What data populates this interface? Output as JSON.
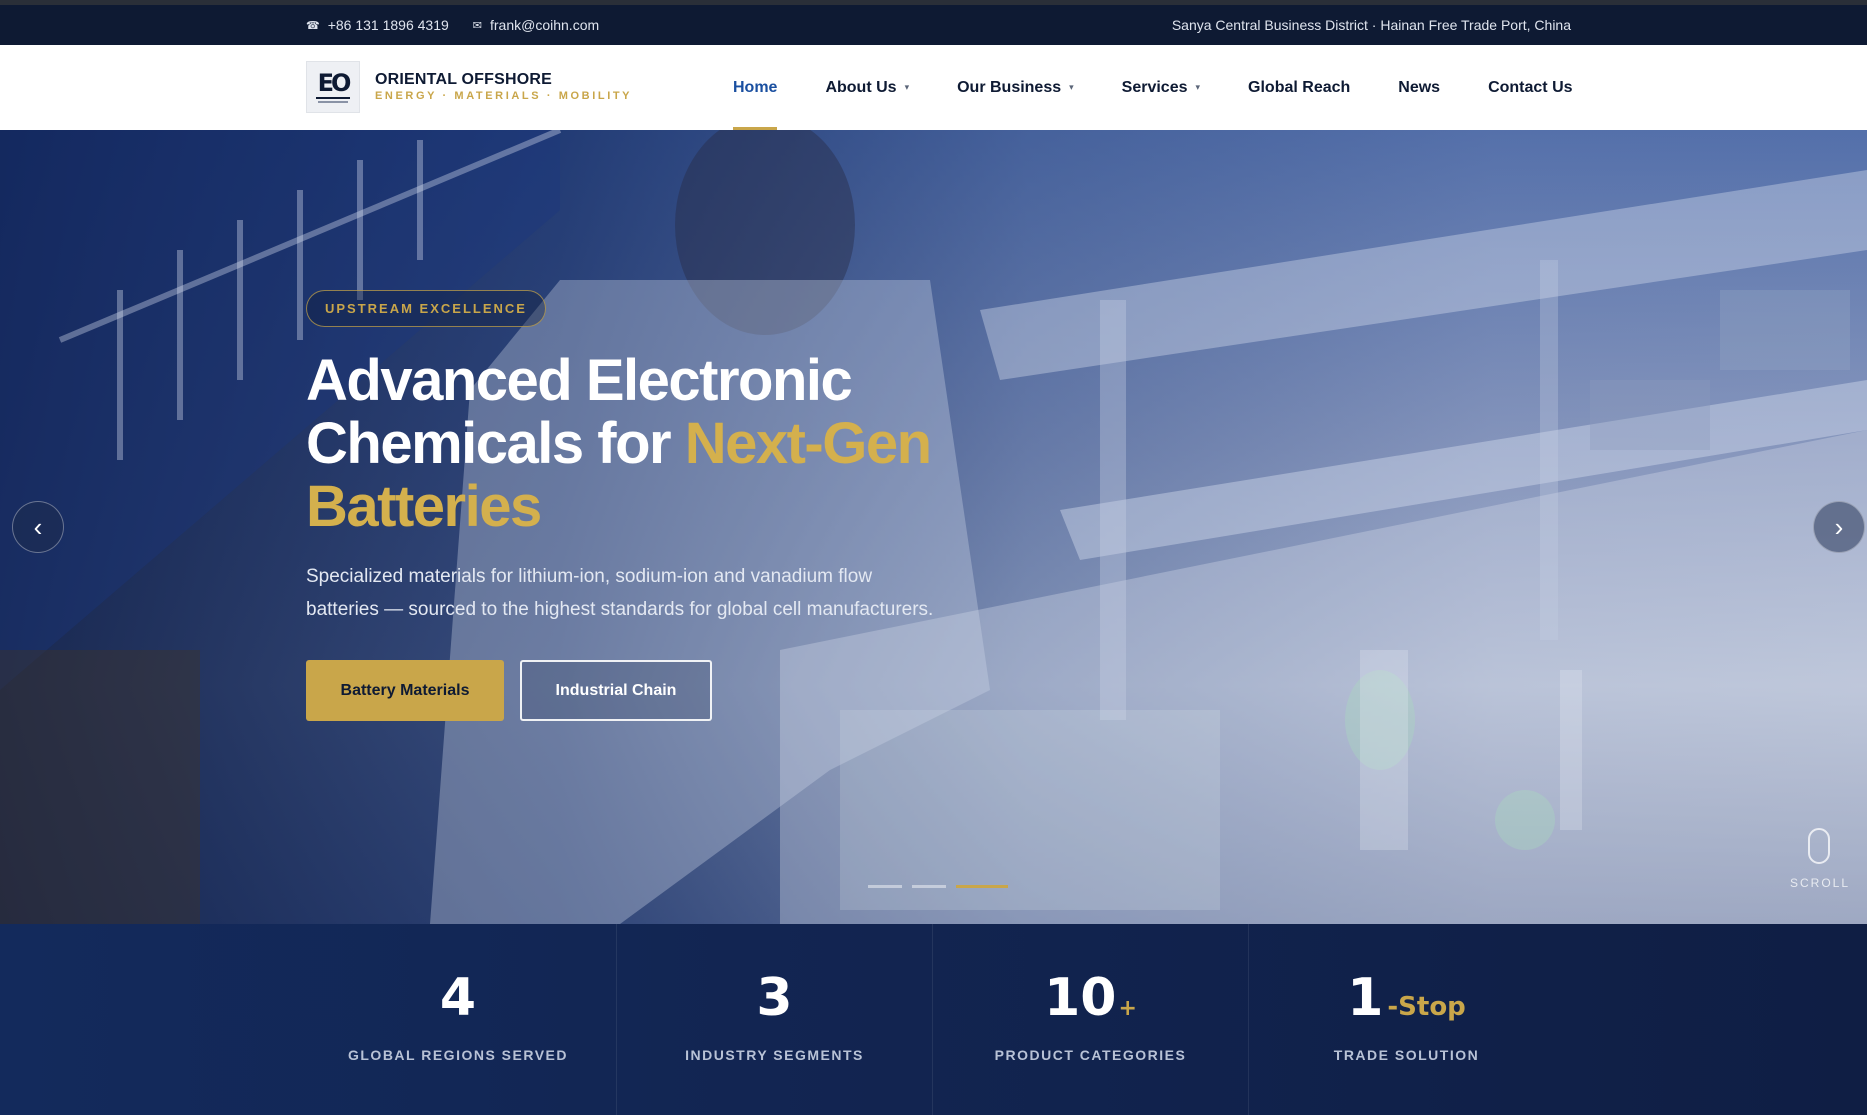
{
  "topbar": {
    "phone": "+86 131 1896 4319",
    "email": "frank@coihn.com",
    "location": "Sanya Central Business District · Hainan Free Trade Port, China",
    "phone_icon": "phone-icon",
    "email_icon": "mail-icon"
  },
  "brand": {
    "mark": "EO",
    "name": "ORIENTAL OFFSHORE",
    "tagline": "ENERGY · MATERIALS · MOBILITY"
  },
  "nav": {
    "items": [
      {
        "label": "Home",
        "active": true
      },
      {
        "label": "About Us",
        "has_dropdown": true
      },
      {
        "label": "Our Business",
        "has_dropdown": true
      },
      {
        "label": "Services",
        "has_dropdown": true
      },
      {
        "label": "Global Reach"
      },
      {
        "label": "News"
      },
      {
        "label": "Contact Us"
      }
    ]
  },
  "hero": {
    "eyebrow": "UPSTREAM EXCELLENCE",
    "title_line1": "Advanced Electronic",
    "title_line2_plain": "Chemicals for ",
    "title_line2_accent": "Next-Gen",
    "title_line3_accent": "Batteries",
    "subtitle": "Specialized materials for lithium-ion, sodium-ion and vanadium flow batteries — sourced to the highest standards for global cell manufacturers.",
    "primary_button": "Battery Materials",
    "secondary_button": "Industrial Chain",
    "prev_arrow": "‹",
    "next_arrow": "›",
    "slide_count": 3,
    "active_slide": 3,
    "scroll_label": "SCROLL"
  },
  "stats": [
    {
      "value": "4",
      "suffix": "",
      "label": "GLOBAL REGIONS SERVED"
    },
    {
      "value": "3",
      "suffix": "",
      "label": "INDUSTRY SEGMENTS"
    },
    {
      "value": "10",
      "suffix": "+",
      "label": "PRODUCT CATEGORIES"
    },
    {
      "value": "1",
      "suffix": "-Stop",
      "label": "TRADE SOLUTION"
    }
  ],
  "colors": {
    "navy": "#0e1a33",
    "gold": "#c9a64a",
    "active_link": "#1a4fa0"
  }
}
